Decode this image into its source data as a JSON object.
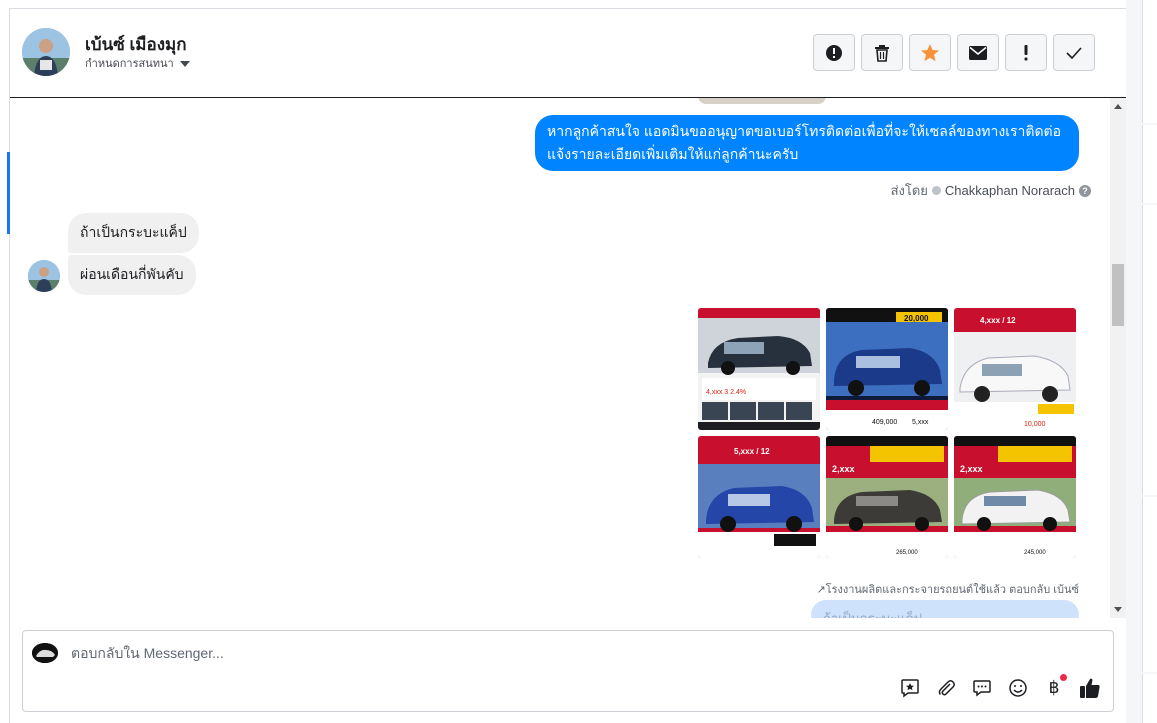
{
  "conversation": {
    "contact_name": "เบ้นซ์ เมืองมุก",
    "assign_label": "กำหนดการสนทนา"
  },
  "toolbar": {
    "actions": [
      {
        "icon": "alert-circle-icon"
      },
      {
        "icon": "trash-icon"
      },
      {
        "icon": "star-icon",
        "color": "#f7923b"
      },
      {
        "icon": "mail-icon"
      },
      {
        "icon": "exclamation-icon"
      },
      {
        "icon": "check-icon"
      }
    ]
  },
  "messages": {
    "outgoing_text": "หากลูกค้าสนใจ แอดมินขออนุญาตขอเบอร์โทรติดต่อเพื่อที่จะให้เซลล์ของทางเราติดต่อแจ้งรายละเอียดเพิ่มเติมให้แก่ลูกค้านะครับ",
    "sent_by_prefix": "ส่งโดย",
    "sent_by_name": "Chakkaphan Norarach",
    "incoming": [
      "ถ้าเป็นกระบะแค็ป",
      "ผ่อนเดือนกี่พันคับ"
    ],
    "reply_note": "↗โรงงานผลิตและกระจายรถยนต์ใช้แล้ว ตอบกลับ เบ้นซ์",
    "partial_text": "ถ้าเป็นกระบะแค็ป"
  },
  "image_grid": [
    {
      "bg": "#2e3a4c",
      "banner": "",
      "price": ""
    },
    {
      "bg": "#1b3a8a",
      "banner": "20,000",
      "price": "5,xxx"
    },
    {
      "bg": "#e8e8e8",
      "banner": "4,xxx / 12",
      "price": "10,000"
    },
    {
      "bg": "#2346a8",
      "banner": "5,xxx / 12",
      "price": ""
    },
    {
      "bg": "#3d3b38",
      "banner": "2,xxx",
      "price": "265,000"
    },
    {
      "bg": "#e9ecef",
      "banner": "2,xxx",
      "price": "245,000"
    }
  ],
  "composer": {
    "placeholder": "ตอบกลับใน Messenger...",
    "tools": [
      "saved-reply-icon",
      "attachment-icon",
      "chat-bubble-icon",
      "emoji-icon",
      "baht-icon",
      "thumbs-up-icon"
    ]
  },
  "colors": {
    "brand_blue": "#0084ff",
    "incoming_bubble": "#f1f0f0",
    "star_orange": "#f7923b"
  }
}
